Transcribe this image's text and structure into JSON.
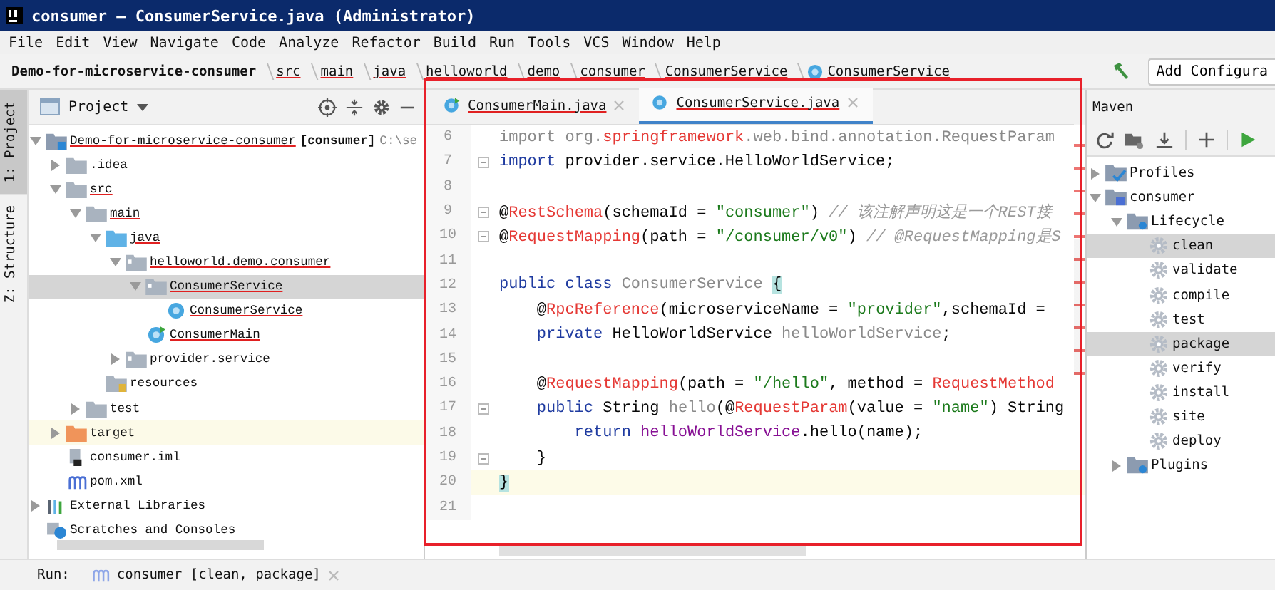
{
  "window": {
    "title": "consumer – ConsumerService.java (Administrator)"
  },
  "menu": [
    "File",
    "Edit",
    "View",
    "Navigate",
    "Code",
    "Analyze",
    "Refactor",
    "Build",
    "Run",
    "Tools",
    "VCS",
    "Window",
    "Help"
  ],
  "breadcrumbs": [
    {
      "label": "Demo-for-microservice-consumer",
      "flagged": false,
      "kind": "root"
    },
    {
      "label": "src",
      "flagged": true,
      "kind": "plain"
    },
    {
      "label": "main",
      "flagged": true,
      "kind": "plain"
    },
    {
      "label": "java",
      "flagged": true,
      "kind": "plain"
    },
    {
      "label": "helloworld",
      "flagged": true,
      "kind": "plain"
    },
    {
      "label": "demo",
      "flagged": true,
      "kind": "plain"
    },
    {
      "label": "consumer",
      "flagged": true,
      "kind": "plain"
    },
    {
      "label": "ConsumerService",
      "flagged": true,
      "kind": "plain"
    },
    {
      "label": "ConsumerService",
      "flagged": true,
      "kind": "class"
    }
  ],
  "toolbar": {
    "run_config": "Add Configura"
  },
  "side_tabs": [
    {
      "label": "1: Project",
      "selected": true
    },
    {
      "label": "Z: Structure",
      "selected": false
    }
  ],
  "project": {
    "title": "Project",
    "tree": [
      {
        "label": "Demo-for-microservice-consumer",
        "module": "[consumer]",
        "path": "C:\\se",
        "kind": "module",
        "flagged": true,
        "selected": false,
        "expanded": true,
        "children": [
          {
            "label": ".idea",
            "kind": "folder",
            "flagged": false,
            "selected": false,
            "expanded": false
          },
          {
            "label": "src",
            "kind": "folder",
            "flagged": true,
            "selected": false,
            "expanded": true,
            "children": [
              {
                "label": "main",
                "kind": "folder",
                "flagged": true,
                "selected": false,
                "expanded": true,
                "children": [
                  {
                    "label": "java",
                    "kind": "source",
                    "flagged": true,
                    "selected": false,
                    "expanded": true,
                    "children": [
                      {
                        "label": "helloworld.demo.consumer",
                        "kind": "package",
                        "flagged": true,
                        "selected": false,
                        "expanded": true,
                        "children": [
                          {
                            "label": "ConsumerService",
                            "kind": "package",
                            "flagged": true,
                            "selected": true,
                            "expanded": true,
                            "children": [
                              {
                                "label": "ConsumerService",
                                "kind": "class",
                                "flagged": true,
                                "selected": false
                              }
                            ]
                          },
                          {
                            "label": "ConsumerMain",
                            "kind": "main-class",
                            "flagged": true,
                            "selected": false
                          }
                        ]
                      },
                      {
                        "label": "provider.service",
                        "kind": "package",
                        "flagged": false,
                        "selected": false,
                        "expanded": false
                      }
                    ]
                  },
                  {
                    "label": "resources",
                    "kind": "resources",
                    "flagged": false,
                    "selected": false
                  }
                ]
              },
              {
                "label": "test",
                "kind": "folder",
                "flagged": false,
                "selected": false,
                "expanded": false
              }
            ]
          },
          {
            "label": "target",
            "kind": "excluded",
            "flagged": false,
            "selected": false,
            "expanded": false
          },
          {
            "label": "consumer.iml",
            "kind": "iml",
            "flagged": false,
            "selected": false
          },
          {
            "label": "pom.xml",
            "kind": "maven",
            "flagged": false,
            "selected": false
          }
        ]
      },
      {
        "label": "External Libraries",
        "kind": "libraries",
        "flagged": false,
        "selected": false,
        "expanded": false
      },
      {
        "label": "Scratches and Consoles",
        "kind": "scratches",
        "flagged": false,
        "selected": false
      }
    ]
  },
  "editor": {
    "tabs": [
      {
        "label": "ConsumerMain.java",
        "kind": "main-class",
        "selected": false
      },
      {
        "label": "ConsumerService.java",
        "kind": "class",
        "selected": true
      }
    ],
    "lines": [
      {
        "number": "6",
        "fold": false,
        "current": false,
        "segments": [
          {
            "text": "import org.",
            "kind": "unused"
          },
          {
            "text": "springframework",
            "kind": "error"
          },
          {
            "text": ".web.bind.annotation.RequestParam",
            "kind": "unused"
          }
        ]
      },
      {
        "number": "7",
        "fold": true,
        "current": false,
        "segments": [
          {
            "text": "import",
            "kind": "keyword"
          },
          {
            "text": " provider.service.HelloWorldService;",
            "kind": "plain"
          }
        ]
      },
      {
        "number": "8",
        "fold": false,
        "current": false
      },
      {
        "number": "9",
        "fold": true,
        "current": false,
        "segments": [
          {
            "text": "@",
            "kind": "plain"
          },
          {
            "text": "RestSchema",
            "kind": "error"
          },
          {
            "text": "(schemaId = ",
            "kind": "plain"
          },
          {
            "text": "\"consumer\"",
            "kind": "string"
          },
          {
            "text": ") ",
            "kind": "plain"
          },
          {
            "text": "// 该注解声明这是一个REST接",
            "kind": "comment"
          }
        ]
      },
      {
        "number": "10",
        "fold": true,
        "current": false,
        "segments": [
          {
            "text": "@",
            "kind": "plain"
          },
          {
            "text": "RequestMapping",
            "kind": "error"
          },
          {
            "text": "(path = ",
            "kind": "plain"
          },
          {
            "text": "\"/consumer/v0\"",
            "kind": "string"
          },
          {
            "text": ") ",
            "kind": "plain"
          },
          {
            "text": "// @RequestMapping是S",
            "kind": "comment"
          }
        ]
      },
      {
        "number": "11",
        "fold": false,
        "current": false
      },
      {
        "number": "12",
        "fold": false,
        "current": false,
        "segments": [
          {
            "text": "public class ",
            "kind": "keyword"
          },
          {
            "text": "ConsumerService ",
            "kind": "unused"
          },
          {
            "text": "{",
            "kind": "brace"
          }
        ]
      },
      {
        "number": "13",
        "fold": false,
        "current": false,
        "segments": [
          {
            "text": "    @",
            "kind": "plain"
          },
          {
            "text": "RpcReference",
            "kind": "error"
          },
          {
            "text": "(microserviceName = ",
            "kind": "plain"
          },
          {
            "text": "\"provider\"",
            "kind": "string"
          },
          {
            "text": ",schemaId =",
            "kind": "plain"
          }
        ]
      },
      {
        "number": "14",
        "fold": false,
        "current": false,
        "segments": [
          {
            "text": "    private ",
            "kind": "keyword"
          },
          {
            "text": "HelloWorldService ",
            "kind": "plain"
          },
          {
            "text": "helloWorldService",
            "kind": "unused"
          },
          {
            "text": ";",
            "kind": "plain"
          }
        ]
      },
      {
        "number": "15",
        "fold": false,
        "current": false
      },
      {
        "number": "16",
        "fold": false,
        "current": false,
        "segments": [
          {
            "text": "    @",
            "kind": "plain"
          },
          {
            "text": "RequestMapping",
            "kind": "error"
          },
          {
            "text": "(path = ",
            "kind": "plain"
          },
          {
            "text": "\"/hello\"",
            "kind": "string"
          },
          {
            "text": ", method = ",
            "kind": "plain"
          },
          {
            "text": "RequestMethod",
            "kind": "error"
          }
        ]
      },
      {
        "number": "17",
        "fold": true,
        "current": false,
        "segments": [
          {
            "text": "    public ",
            "kind": "keyword"
          },
          {
            "text": "String ",
            "kind": "plain"
          },
          {
            "text": "hello",
            "kind": "unused"
          },
          {
            "text": "(@",
            "kind": "plain"
          },
          {
            "text": "RequestParam",
            "kind": "error"
          },
          {
            "text": "(value = ",
            "kind": "plain"
          },
          {
            "text": "\"name\"",
            "kind": "string"
          },
          {
            "text": ") String",
            "kind": "plain"
          }
        ]
      },
      {
        "number": "18",
        "fold": false,
        "current": false,
        "segments": [
          {
            "text": "        return ",
            "kind": "keyword"
          },
          {
            "text": "helloWorldService",
            "kind": "field"
          },
          {
            "text": ".hello(name);",
            "kind": "plain"
          }
        ]
      },
      {
        "number": "19",
        "fold": true,
        "current": false,
        "segments": [
          {
            "text": "    }",
            "kind": "plain"
          }
        ]
      },
      {
        "number": "20",
        "fold": false,
        "current": true,
        "segments": [
          {
            "text": "}",
            "kind": "brace"
          }
        ]
      },
      {
        "number": "21",
        "fold": false,
        "current": false
      }
    ]
  },
  "maven": {
    "title": "Maven",
    "tree": [
      {
        "label": "Profiles",
        "kind": "profiles",
        "selected": false,
        "expanded": false
      },
      {
        "label": "consumer",
        "kind": "maven-module",
        "selected": false,
        "expanded": true,
        "children": [
          {
            "label": "Lifecycle",
            "kind": "lifecycle",
            "selected": false,
            "expanded": true,
            "children": [
              {
                "label": "clean",
                "kind": "goal",
                "selected": true
              },
              {
                "label": "validate",
                "kind": "goal",
                "selected": false
              },
              {
                "label": "compile",
                "kind": "goal",
                "selected": false
              },
              {
                "label": "test",
                "kind": "goal",
                "selected": false
              },
              {
                "label": "package",
                "kind": "goal",
                "selected": true
              },
              {
                "label": "verify",
                "kind": "goal",
                "selected": false
              },
              {
                "label": "install",
                "kind": "goal",
                "selected": false
              },
              {
                "label": "site",
                "kind": "goal",
                "selected": false
              },
              {
                "label": "deploy",
                "kind": "goal",
                "selected": false
              }
            ]
          },
          {
            "label": "Plugins",
            "kind": "lifecycle",
            "selected": false,
            "expanded": false
          }
        ]
      }
    ]
  },
  "run_bar": {
    "label": "Run:",
    "tab": "consumer [clean, package]"
  }
}
